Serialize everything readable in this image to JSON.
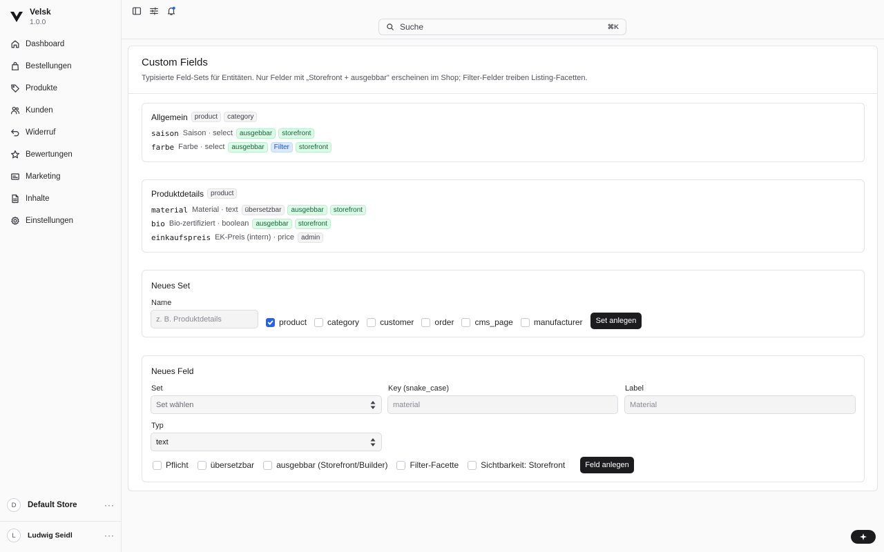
{
  "brand": {
    "name": "Velsk",
    "version": "1.0.0"
  },
  "sidebar": {
    "items": [
      {
        "label": "Dashboard",
        "icon": "home-icon"
      },
      {
        "label": "Bestellungen",
        "icon": "shopping-bag-icon"
      },
      {
        "label": "Produkte",
        "icon": "tag-icon"
      },
      {
        "label": "Kunden",
        "icon": "users-icon"
      },
      {
        "label": "Widerruf",
        "icon": "undo-icon"
      },
      {
        "label": "Bewertungen",
        "icon": "star-icon"
      },
      {
        "label": "Marketing",
        "icon": "mail-icon"
      },
      {
        "label": "Inhalte",
        "icon": "document-icon"
      },
      {
        "label": "Einstellungen",
        "icon": "gear-icon"
      }
    ],
    "store": {
      "initial": "D",
      "name": "Default Store",
      "more": "···"
    },
    "user": {
      "initial": "L",
      "name": "Ludwig Seidl",
      "more": "···"
    }
  },
  "topbar": {
    "search_placeholder": "Suche",
    "search_shortcut": "⌘K"
  },
  "page": {
    "title": "Custom Fields",
    "subtitle": "Typisierte Feld-Sets für Entitäten. Nur Felder mit „Storefront + ausgebbar\" erscheinen im Shop; Filter-Felder treiben Listing-Facetten."
  },
  "sets": [
    {
      "name": "Allgemein",
      "entities": [
        "product",
        "category"
      ],
      "fields": [
        {
          "key": "saison",
          "desc": "Saison · select",
          "badges": [
            {
              "text": "ausgebbar",
              "kind": "green"
            },
            {
              "text": "storefront",
              "kind": "green"
            }
          ]
        },
        {
          "key": "farbe",
          "desc": "Farbe · select",
          "badges": [
            {
              "text": "ausgebbar",
              "kind": "green"
            },
            {
              "text": "Filter",
              "kind": "blue"
            },
            {
              "text": "storefront",
              "kind": "green"
            }
          ]
        }
      ]
    },
    {
      "name": "Produktdetails",
      "entities": [
        "product"
      ],
      "fields": [
        {
          "key": "material",
          "desc": "Material · text",
          "badges": [
            {
              "text": "übersetzbar",
              "kind": "gray"
            },
            {
              "text": "ausgebbar",
              "kind": "green"
            },
            {
              "text": "storefront",
              "kind": "green"
            }
          ]
        },
        {
          "key": "bio",
          "desc": "Bio-zertifiziert · boolean",
          "badges": [
            {
              "text": "ausgebbar",
              "kind": "green"
            },
            {
              "text": "storefront",
              "kind": "green"
            }
          ]
        },
        {
          "key": "einkaufspreis",
          "desc": "EK-Preis (intern) · price",
          "badges": [
            {
              "text": "admin",
              "kind": "gray"
            }
          ]
        }
      ]
    }
  ],
  "new_set": {
    "title": "Neues Set",
    "name_label": "Name",
    "name_placeholder": "z. B. Produktdetails",
    "entities": [
      {
        "label": "product",
        "checked": true
      },
      {
        "label": "category",
        "checked": false
      },
      {
        "label": "customer",
        "checked": false
      },
      {
        "label": "order",
        "checked": false
      },
      {
        "label": "cms_page",
        "checked": false
      },
      {
        "label": "manufacturer",
        "checked": false
      }
    ],
    "submit_label": "Set anlegen"
  },
  "new_field": {
    "title": "Neues Feld",
    "set_label": "Set",
    "set_value": "Set wählen",
    "key_label": "Key (snake_case)",
    "key_placeholder": "material",
    "label_label": "Label",
    "label_placeholder": "Material",
    "type_label": "Typ",
    "type_value": "text",
    "options": [
      {
        "label": "Pflicht",
        "checked": false
      },
      {
        "label": "übersetzbar",
        "checked": false
      },
      {
        "label": "ausgebbar (Storefront/Builder)",
        "checked": false
      },
      {
        "label": "Filter-Facette",
        "checked": false
      },
      {
        "label": "Sichtbarkeit: Storefront",
        "checked": false
      }
    ],
    "submit_label": "Feld anlegen"
  }
}
